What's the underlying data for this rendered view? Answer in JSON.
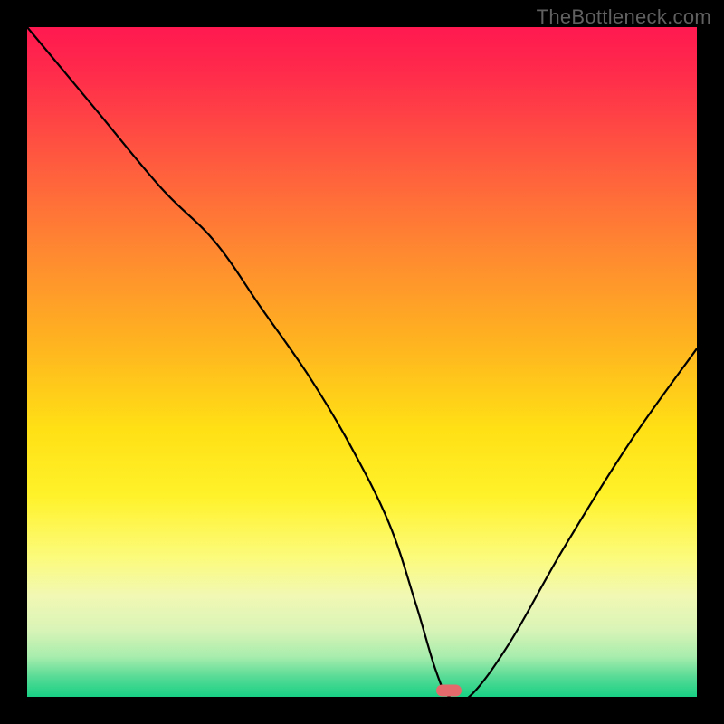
{
  "source_label": "TheBottleneck.com",
  "colors": {
    "frame": "#000000",
    "gradient_top": "#ff1850",
    "gradient_bottom": "#18d084",
    "marker": "#e56a6b",
    "curve": "#000000"
  },
  "marker": {
    "x_pct": 63,
    "y_pct": 99
  },
  "chart_data": {
    "type": "line",
    "title": "",
    "xlabel": "",
    "ylabel": "",
    "xlim": [
      0,
      100
    ],
    "ylim": [
      0,
      100
    ],
    "grid": false,
    "legend": null,
    "annotations": [
      {
        "text": "TheBottleneck.com",
        "position": "top-right"
      }
    ],
    "series": [
      {
        "name": "bottleneck-curve",
        "x": [
          0,
          10,
          20,
          28,
          35,
          42,
          48,
          54,
          58,
          61,
          63,
          66,
          72,
          80,
          90,
          100
        ],
        "values": [
          100,
          88,
          76,
          68,
          58,
          48,
          38,
          26,
          14,
          4,
          0,
          0,
          8,
          22,
          38,
          52
        ]
      }
    ],
    "background_gradient": {
      "direction": "vertical",
      "stops": [
        {
          "pct": 0,
          "color": "#ff1850"
        },
        {
          "pct": 34,
          "color": "#ff8a30"
        },
        {
          "pct": 60,
          "color": "#ffe015"
        },
        {
          "pct": 85,
          "color": "#f1f8b4"
        },
        {
          "pct": 100,
          "color": "#18d084"
        }
      ]
    },
    "marker_point": {
      "x": 63,
      "y": 0
    }
  }
}
